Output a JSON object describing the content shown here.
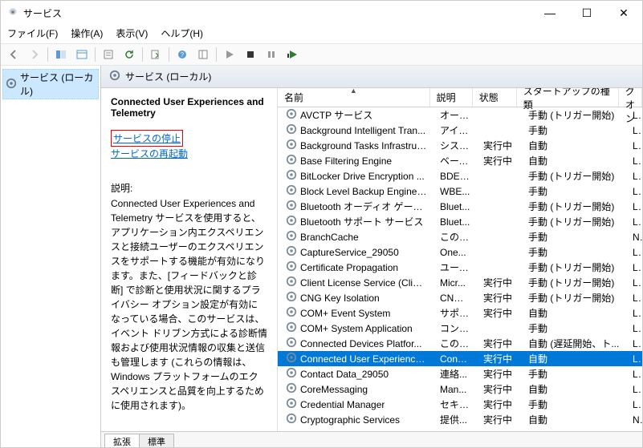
{
  "window": {
    "title": "サービス"
  },
  "menus": {
    "file": "ファイル(F)",
    "action": "操作(A)",
    "view": "表示(V)",
    "help": "ヘルプ(H)"
  },
  "tree": {
    "root": "サービス (ローカル)"
  },
  "content_header": "サービス (ローカル)",
  "detail": {
    "selected_name": "Connected User Experiences and Telemetry",
    "stop_label": "サービスの停止",
    "restart_label": "サービスの再起動",
    "desc_heading": "説明:",
    "desc_body": "Connected User Experiences and Telemetry サービスを使用すると、アプリケーション内エクスペリエンスと接続ユーザーのエクスペリエンスをサポートする機能が有効になります。また、[フィードバックと診断] で診断と使用状況に関するプライバシー オプション設定が有効になっている場合、このサービスは、イベント ドリブン方式による診断情報および使用状況情報の収集と送信も管理します (これらの情報は、Windows プラットフォームのエクスペリエンスと品質を向上するために使用されます)。"
  },
  "columns": {
    "name": "名前",
    "desc": "説明",
    "state": "状態",
    "startup": "スタートアップの種類",
    "logon": "ログオン"
  },
  "sort_indicator": "▲",
  "services": [
    {
      "name": "AVCTP サービス",
      "desc": "オーデ...",
      "state": "",
      "startup": "手動 (トリガー開始)",
      "logon": "Local S"
    },
    {
      "name": "Background Intelligent Tran...",
      "desc": "アイド...",
      "state": "",
      "startup": "手動",
      "logon": "Local S"
    },
    {
      "name": "Background Tasks Infrastruc...",
      "desc": "システ...",
      "state": "実行中",
      "startup": "自動",
      "logon": "Local S"
    },
    {
      "name": "Base Filtering Engine",
      "desc": "ベース...",
      "state": "実行中",
      "startup": "自動",
      "logon": "Local S"
    },
    {
      "name": "BitLocker Drive Encryption ...",
      "desc": "BDES...",
      "state": "",
      "startup": "手動 (トリガー開始)",
      "logon": "Local S"
    },
    {
      "name": "Block Level Backup Engine ...",
      "desc": "WBE...",
      "state": "",
      "startup": "手動",
      "logon": "Local S"
    },
    {
      "name": "Bluetooth オーディオ ゲートウェ...",
      "desc": "Bluet...",
      "state": "",
      "startup": "手動 (トリガー開始)",
      "logon": "Local S"
    },
    {
      "name": "Bluetooth サポート サービス",
      "desc": "Bluet...",
      "state": "",
      "startup": "手動 (トリガー開始)",
      "logon": "Local S"
    },
    {
      "name": "BranchCache",
      "desc": "このサ...",
      "state": "",
      "startup": "手動",
      "logon": "Network"
    },
    {
      "name": "CaptureService_29050",
      "desc": "One...",
      "state": "",
      "startup": "手動",
      "logon": "Local S"
    },
    {
      "name": "Certificate Propagation",
      "desc": "ユーザ...",
      "state": "",
      "startup": "手動 (トリガー開始)",
      "logon": "Local S"
    },
    {
      "name": "Client License Service (ClipS...",
      "desc": "Micr...",
      "state": "実行中",
      "startup": "手動 (トリガー開始)",
      "logon": "Local S"
    },
    {
      "name": "CNG Key Isolation",
      "desc": "CNG ...",
      "state": "実行中",
      "startup": "手動 (トリガー開始)",
      "logon": "Local S"
    },
    {
      "name": "COM+ Event System",
      "desc": "サポー...",
      "state": "実行中",
      "startup": "自動",
      "logon": "Local S"
    },
    {
      "name": "COM+ System Application",
      "desc": "コンポ...",
      "state": "",
      "startup": "手動",
      "logon": "Local S"
    },
    {
      "name": "Connected Devices Platfor...",
      "desc": "このサ...",
      "state": "実行中",
      "startup": "自動 (遅延開始、ト...",
      "logon": "Local S"
    },
    {
      "name": "Connected User Experience...",
      "desc": "Conn...",
      "state": "実行中",
      "startup": "自動",
      "logon": "Local S",
      "selected": true
    },
    {
      "name": "Contact Data_29050",
      "desc": "連絡...",
      "state": "実行中",
      "startup": "手動",
      "logon": "Local S"
    },
    {
      "name": "CoreMessaging",
      "desc": "Man...",
      "state": "実行中",
      "startup": "自動",
      "logon": "Local S"
    },
    {
      "name": "Credential Manager",
      "desc": "セキュ...",
      "state": "実行中",
      "startup": "手動",
      "logon": "Local S"
    },
    {
      "name": "Cryptographic Services",
      "desc": "提供...",
      "state": "実行中",
      "startup": "自動",
      "logon": "Network"
    }
  ],
  "tabs": {
    "extended": "拡張",
    "standard": "標準"
  }
}
